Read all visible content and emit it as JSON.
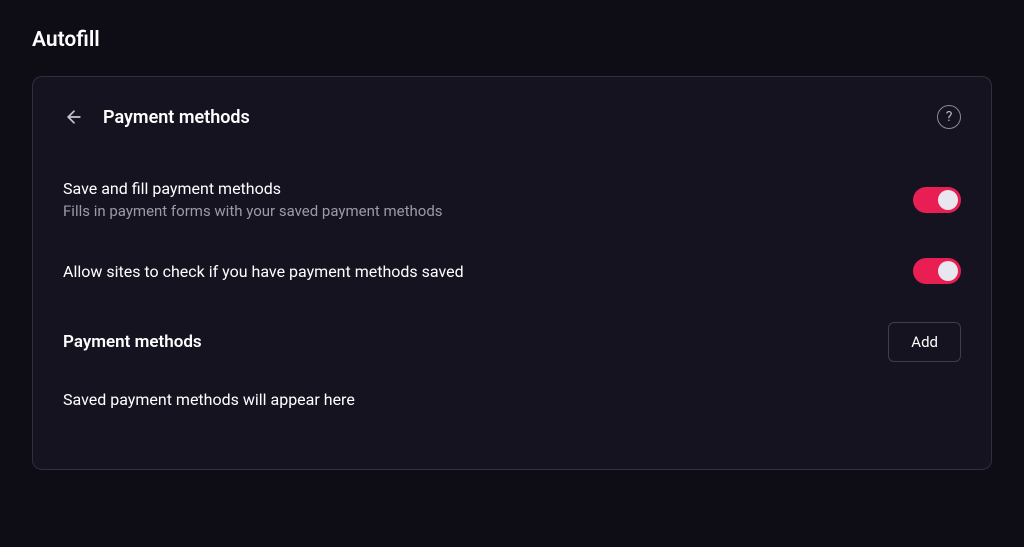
{
  "page": {
    "title": "Autofill"
  },
  "card": {
    "title": "Payment methods"
  },
  "settings": [
    {
      "title": "Save and fill payment methods",
      "description": "Fills in payment forms with your saved payment methods",
      "enabled": true
    },
    {
      "title": "Allow sites to check if you have payment methods saved",
      "description": "",
      "enabled": true
    }
  ],
  "paymentSection": {
    "title": "Payment methods",
    "addButton": "Add",
    "emptyMessage": "Saved payment methods will appear here"
  }
}
